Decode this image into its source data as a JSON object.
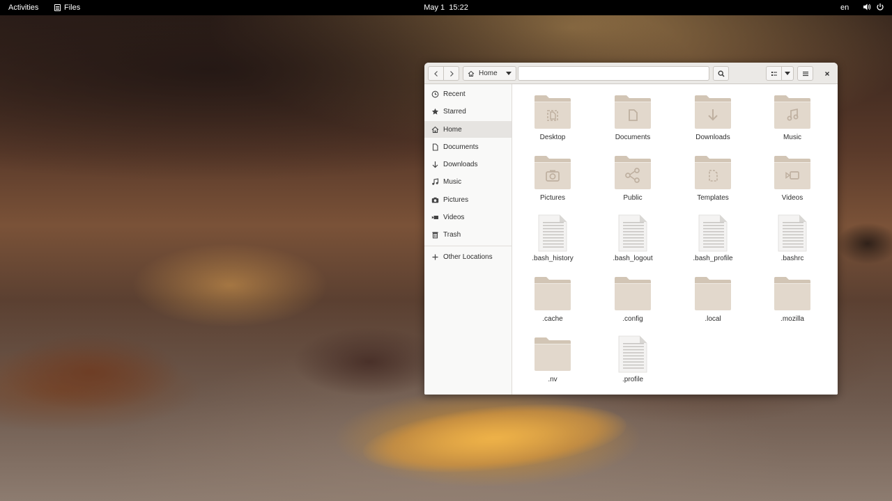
{
  "topbar": {
    "activities": "Activities",
    "app_name": "Files",
    "date": "May 1",
    "time": "15:22",
    "language": "en"
  },
  "window": {
    "path_label": "Home",
    "location_value": ""
  },
  "sidebar": {
    "items": [
      {
        "label": "Recent",
        "icon": "clock-icon"
      },
      {
        "label": "Starred",
        "icon": "star-icon"
      },
      {
        "label": "Home",
        "icon": "home-icon",
        "active": true
      },
      {
        "label": "Documents",
        "icon": "document-icon"
      },
      {
        "label": "Downloads",
        "icon": "download-icon"
      },
      {
        "label": "Music",
        "icon": "music-icon"
      },
      {
        "label": "Pictures",
        "icon": "camera-icon"
      },
      {
        "label": "Videos",
        "icon": "video-icon"
      },
      {
        "label": "Trash",
        "icon": "trash-icon"
      }
    ],
    "other_locations": "Other Locations"
  },
  "files": [
    {
      "name": "Desktop",
      "kind": "folder",
      "emblem": "desktop"
    },
    {
      "name": "Documents",
      "kind": "folder",
      "emblem": "document"
    },
    {
      "name": "Downloads",
      "kind": "folder",
      "emblem": "download"
    },
    {
      "name": "Music",
      "kind": "folder",
      "emblem": "music"
    },
    {
      "name": "Pictures",
      "kind": "folder",
      "emblem": "camera"
    },
    {
      "name": "Public",
      "kind": "folder",
      "emblem": "share"
    },
    {
      "name": "Templates",
      "kind": "folder",
      "emblem": "template"
    },
    {
      "name": "Videos",
      "kind": "folder",
      "emblem": "video"
    },
    {
      "name": ".bash_history",
      "kind": "text"
    },
    {
      "name": ".bash_logout",
      "kind": "text"
    },
    {
      "name": ".bash_profile",
      "kind": "text"
    },
    {
      "name": ".bashrc",
      "kind": "text"
    },
    {
      "name": ".cache",
      "kind": "folder",
      "emblem": "none"
    },
    {
      "name": ".config",
      "kind": "folder",
      "emblem": "none"
    },
    {
      "name": ".local",
      "kind": "folder",
      "emblem": "none"
    },
    {
      "name": ".mozilla",
      "kind": "folder",
      "emblem": "none"
    },
    {
      "name": ".nv",
      "kind": "folder",
      "emblem": "none"
    },
    {
      "name": ".profile",
      "kind": "text"
    }
  ],
  "colors": {
    "folder_back": "#d2c5b5",
    "folder_front": "#e2d8cc",
    "emblem": "#bfb0a0",
    "text_file": "#f4f3f2"
  }
}
